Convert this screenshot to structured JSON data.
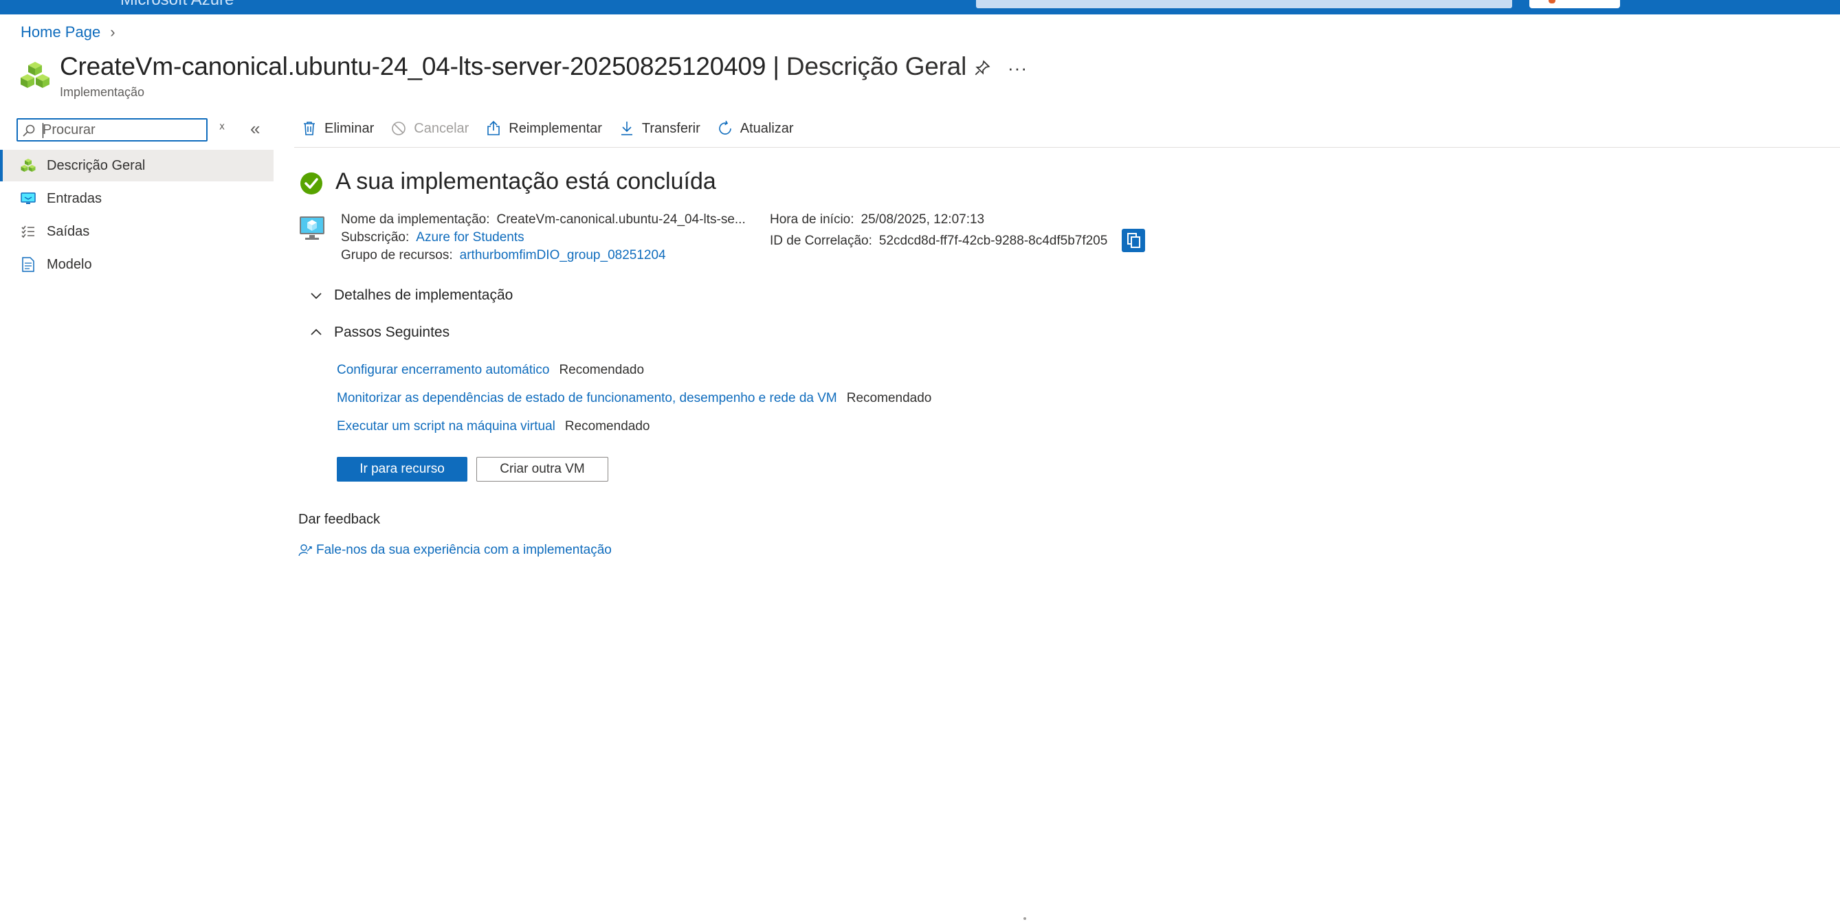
{
  "header": {
    "brand": "Microsoft Azure",
    "accent_color": "#0f6cbd"
  },
  "breadcrumb": {
    "home": "Home Page"
  },
  "title": {
    "name": "CreateVm-canonical.ubuntu-24_04-lts-server-20250825120409",
    "separator": "|",
    "section": "Descrição Geral",
    "subtitle": "Implementação",
    "icon": "deployment-cubes-icon"
  },
  "sidebar": {
    "search_placeholder": "Procurar",
    "items": [
      {
        "label": "Descrição Geral",
        "icon": "cubes-icon",
        "active": true
      },
      {
        "label": "Entradas",
        "icon": "inputs-monitor-icon",
        "active": false
      },
      {
        "label": "Saídas",
        "icon": "outputs-list-icon",
        "active": false
      },
      {
        "label": "Modelo",
        "icon": "template-doc-icon",
        "active": false
      }
    ]
  },
  "toolbar": {
    "delete": "Eliminar",
    "cancel": "Cancelar",
    "redeploy": "Reimplementar",
    "download": "Transferir",
    "refresh": "Atualizar"
  },
  "status": {
    "title": "A sua implementação está concluída",
    "color": "#57a300"
  },
  "details": {
    "deployment_name_label": "Nome da implementação:",
    "deployment_name": "CreateVm-canonical.ubuntu-24_04-lts-se...",
    "subscription_label": "Subscrição:",
    "subscription": "Azure for Students",
    "resource_group_label": "Grupo de recursos:",
    "resource_group": "arthurbomfimDIO_group_08251204",
    "start_time_label": "Hora de início:",
    "start_time": "25/08/2025, 12:07:13",
    "correlation_label": "ID de Correlação:",
    "correlation_id": "52cdcd8d-ff7f-42cb-9288-8c4df5b7f205"
  },
  "sections": {
    "deployment_details": "Detalhes de implementação",
    "next_steps": "Passos Seguintes"
  },
  "next_steps": [
    {
      "link": "Configurar encerramento automático",
      "tag": "Recomendado"
    },
    {
      "link": "Monitorizar as dependências de estado de funcionamento, desempenho e rede da VM",
      "tag": "Recomendado"
    },
    {
      "link": "Executar um script na máquina virtual",
      "tag": "Recomendado"
    }
  ],
  "buttons": {
    "go_to_resource": "Ir para recurso",
    "create_another": "Criar outra VM"
  },
  "feedback": {
    "title": "Dar feedback",
    "link": "Fale-nos da sua experiência com a implementação"
  }
}
